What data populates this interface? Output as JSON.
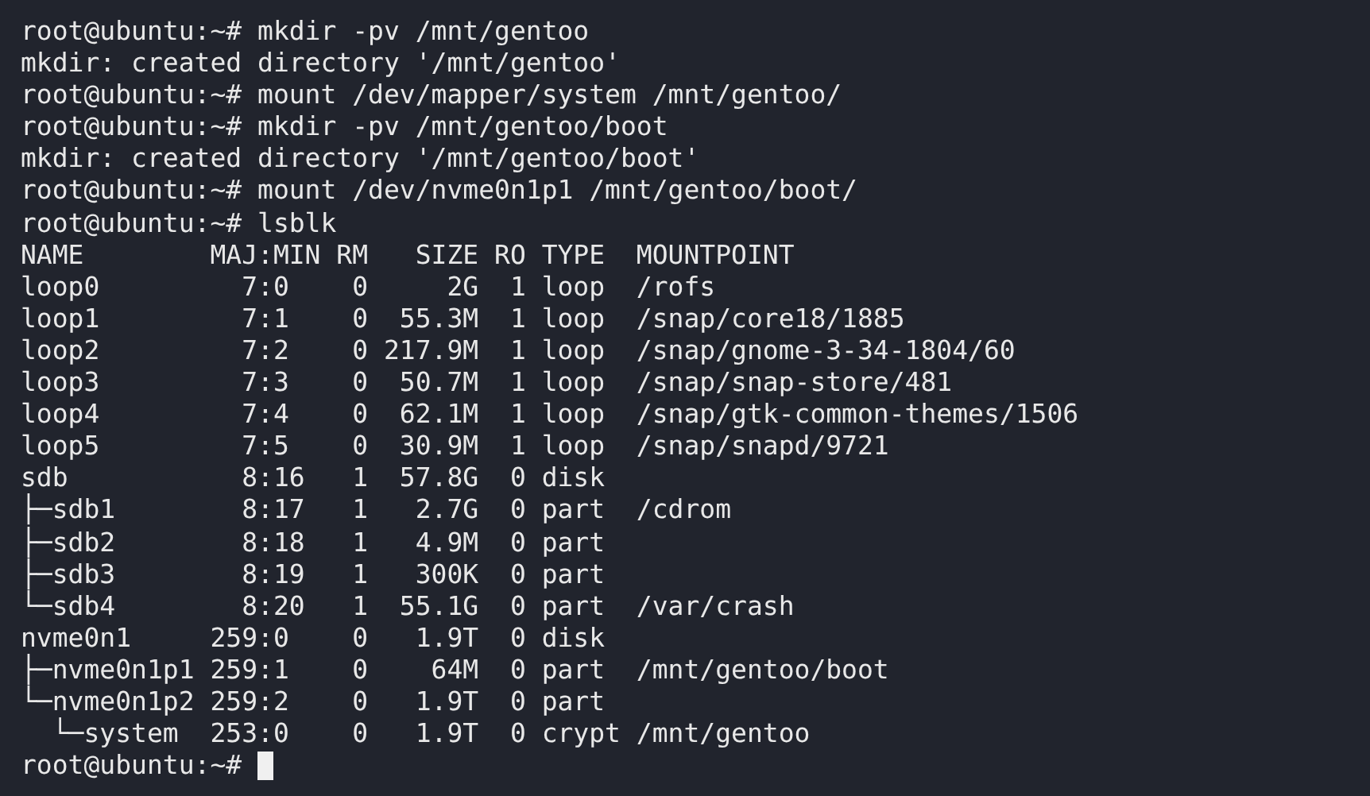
{
  "terminal": {
    "lines": [
      "root@ubuntu:~# mkdir -pv /mnt/gentoo",
      "mkdir: created directory '/mnt/gentoo'",
      "root@ubuntu:~# mount /dev/mapper/system /mnt/gentoo/",
      "root@ubuntu:~# mkdir -pv /mnt/gentoo/boot",
      "mkdir: created directory '/mnt/gentoo/boot'",
      "root@ubuntu:~# mount /dev/nvme0n1p1 /mnt/gentoo/boot/",
      "root@ubuntu:~# lsblk",
      "NAME        MAJ:MIN RM   SIZE RO TYPE  MOUNTPOINT",
      "loop0         7:0    0     2G  1 loop  /rofs",
      "loop1         7:1    0  55.3M  1 loop  /snap/core18/1885",
      "loop2         7:2    0 217.9M  1 loop  /snap/gnome-3-34-1804/60",
      "loop3         7:3    0  50.7M  1 loop  /snap/snap-store/481",
      "loop4         7:4    0  62.1M  1 loop  /snap/gtk-common-themes/1506",
      "loop5         7:5    0  30.9M  1 loop  /snap/snapd/9721",
      "sdb           8:16   1  57.8G  0 disk",
      "├─sdb1        8:17   1   2.7G  0 part  /cdrom",
      "├─sdb2        8:18   1   4.9M  0 part",
      "├─sdb3        8:19   1   300K  0 part",
      "└─sdb4        8:20   1  55.1G  0 part  /var/crash",
      "nvme0n1     259:0    0   1.9T  0 disk",
      "├─nvme0n1p1 259:1    0    64M  0 part  /mnt/gentoo/boot",
      "└─nvme0n1p2 259:2    0   1.9T  0 part",
      "  └─system  253:0    0   1.9T  0 crypt /mnt/gentoo"
    ],
    "prompt": "root@ubuntu:~#",
    "cursor": {
      "visible": true
    }
  }
}
